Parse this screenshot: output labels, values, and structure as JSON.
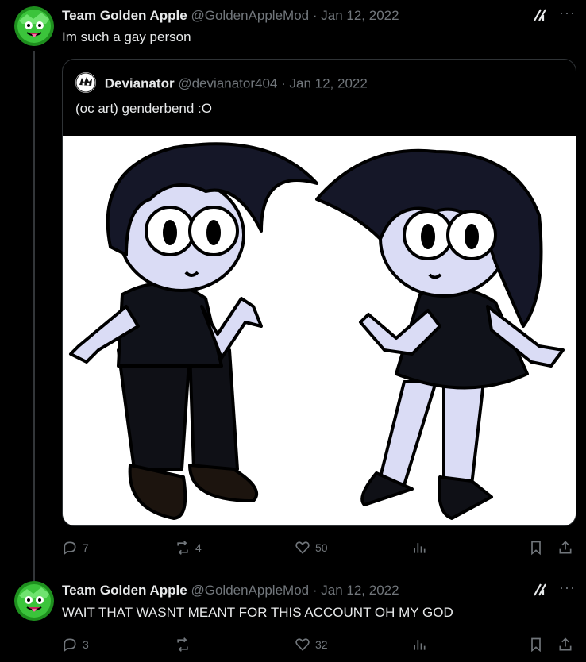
{
  "tweets": [
    {
      "name": "Team Golden Apple",
      "handle": "@GoldenAppleMod",
      "date": "Jan 12, 2022",
      "text": "Im such a gay person",
      "quote": {
        "name": "Devianator",
        "handle": "@devianator404",
        "date": "Jan 12, 2022",
        "text": "(oc art) genderbend :O"
      },
      "replies": "7",
      "reposts": "4",
      "likes": "50"
    },
    {
      "name": "Team Golden Apple",
      "handle": "@GoldenAppleMod",
      "date": "Jan 12, 2022",
      "text": "WAIT THAT WASNT MEANT FOR THIS ACCOUNT OH MY GOD",
      "replies": "3",
      "reposts": "",
      "likes": "32"
    }
  ],
  "icons": {
    "reply": "reply-icon",
    "repost": "repost-icon",
    "like": "like-icon",
    "views": "views-icon",
    "bookmark": "bookmark-icon",
    "share": "share-icon",
    "grok": "grok-icon",
    "more": "more-icon"
  },
  "colors": {
    "background": "#000000",
    "text": "#e7e9ea",
    "muted": "#71767b",
    "border": "#2f3336",
    "avatar_green": "#3bc43b"
  }
}
